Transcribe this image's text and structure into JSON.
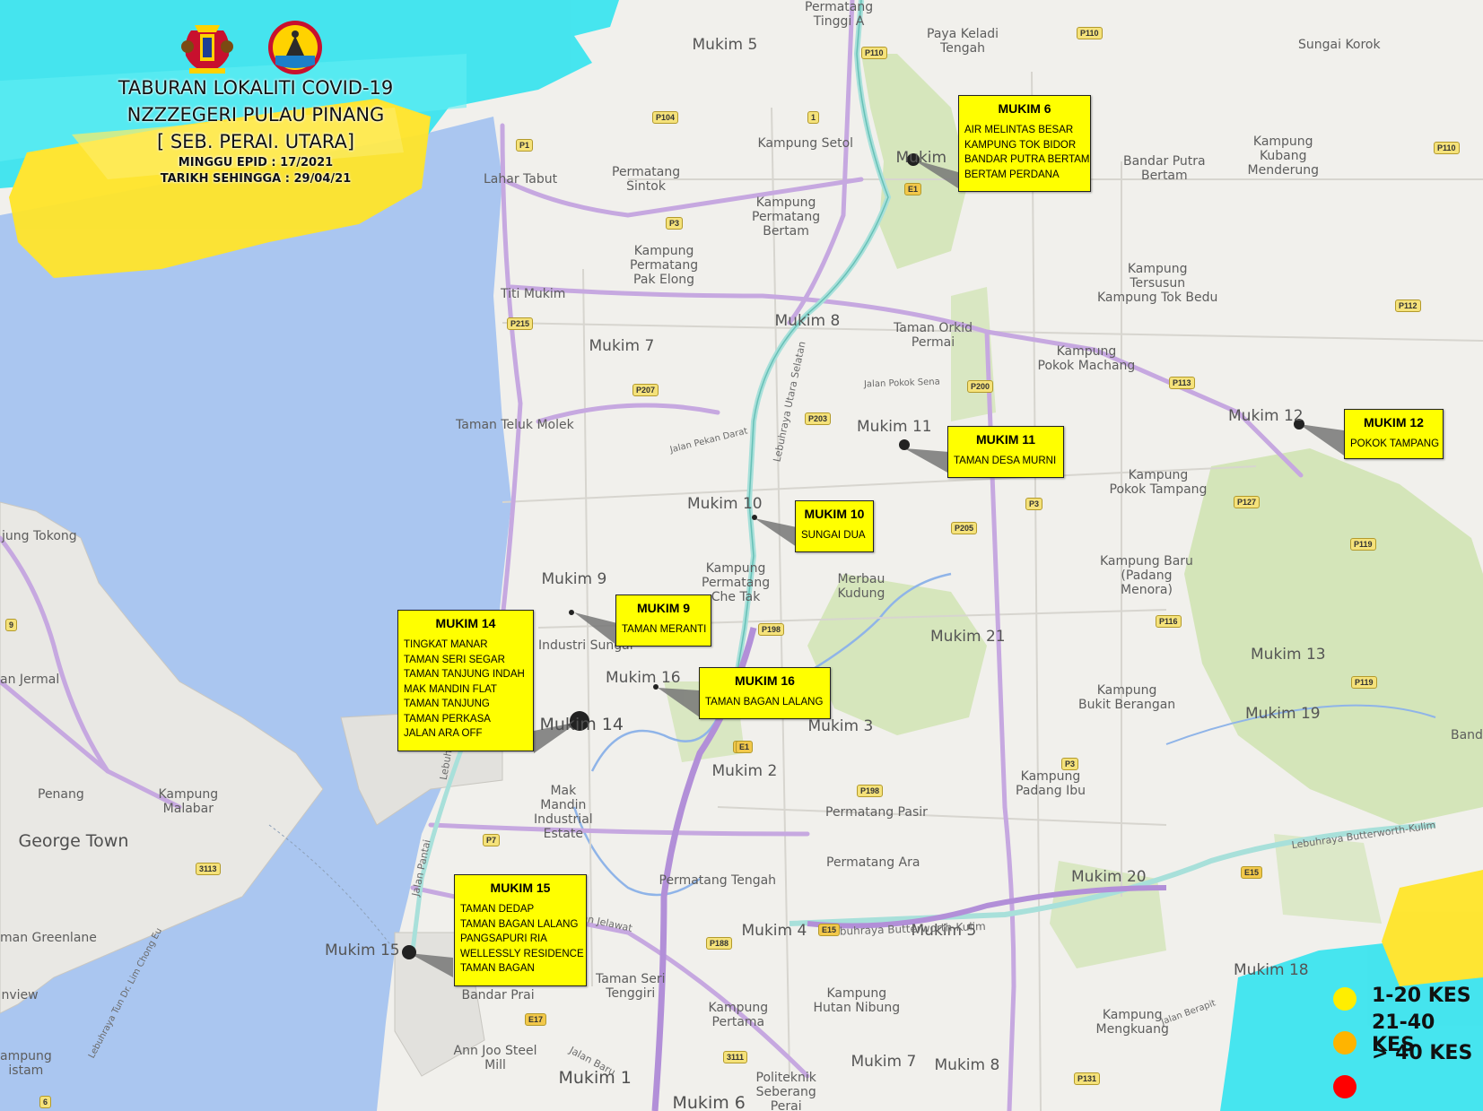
{
  "header": {
    "title_line1": "TABURAN LOKALITI COVID-19",
    "title_line2": "NZZZEGERI PULAU PINANG",
    "title_line3": "[ SEB. PERAI. UTARA]",
    "epid_week": "MINGGU EPID : 17/2021",
    "as_of_date": "TARIKH SEHINGGA : 29/04/21"
  },
  "callouts": {
    "mukim6": {
      "title": "MUKIM 6",
      "items": [
        "AIR MELINTAS BESAR",
        "KAMPUNG TOK BIDOR",
        "BANDAR PUTRA BERTAM",
        "BERTAM PERDANA"
      ]
    },
    "mukim12": {
      "title": "MUKIM 12",
      "items": [
        "POKOK TAMPANG"
      ]
    },
    "mukim11": {
      "title": "MUKIM 11",
      "items": [
        "TAMAN DESA MURNI"
      ]
    },
    "mukim10": {
      "title": "MUKIM 10",
      "items": [
        "SUNGAI DUA"
      ]
    },
    "mukim9": {
      "title": "MUKIM 9",
      "items": [
        "TAMAN MERANTI"
      ]
    },
    "mukim16": {
      "title": "MUKIM 16",
      "items": [
        "TAMAN BAGAN LALANG"
      ]
    },
    "mukim14": {
      "title": "MUKIM 14",
      "items": [
        "TINGKAT MANAR",
        "TAMAN SERI SEGAR",
        "TAMAN TANJUNG INDAH",
        "MAK MANDIN FLAT",
        "TAMAN TANJUNG",
        "TAMAN PERKASA",
        "JALAN ARA OFF"
      ]
    },
    "mukim15": {
      "title": "MUKIM 15",
      "items": [
        "TAMAN DEDAP",
        "TAMAN BAGAN LALANG",
        "PANGSAPURI RIA",
        "WELLESSLY RESIDENCE",
        "TAMAN BAGAN"
      ]
    }
  },
  "legend": {
    "low": {
      "label": "1-20 KES",
      "color": "#ffee00"
    },
    "mid": {
      "label": "21-40 KES",
      "color": "#ffb400"
    },
    "high": {
      "label": "> 40 KES",
      "color": "#ff0000"
    }
  },
  "place_labels": {
    "permatang_tinggi_a": "Permatang\nTinggi A",
    "mukim5_n": "Mukim 5",
    "paya_keladi": "Paya Keladi\nTengah",
    "sungai_korok": "Sungai Korok",
    "kampung_setol": "Kampung Setol",
    "mukim6": "Mukim",
    "bandar_putra": "Bandar Putra\nBertam",
    "kubang": "Kampung\nKubang\nMenderung",
    "lahar_tabut": "Lahar Tabut",
    "permatang_sintok": "Permatang\nSintok",
    "pp_bertam": "Kampung\nPermatang\nBertam",
    "pak_elong": "Kampung\nPermatang\nPak Elong",
    "tersusun": "Kampung\nTersusun\nKampung Tok Bedu",
    "titi_mukim": "Titi Mukim",
    "mukim8": "Mukim 8",
    "orkid": "Taman Orkid\nPermai",
    "mukim7": "Mukim 7",
    "pokok_machang": "Kampung\nPokok Machang",
    "teluk_molek": "Taman Teluk Molek",
    "mukim11": "Mukim 11",
    "mukim12": "Mukim 12",
    "pokok_tampang": "Kampung\nPokok Tampang",
    "mukim10": "Mukim 10",
    "tokong": "jung Tokong",
    "mukim9": "Mukim 9",
    "che_tak": "Kampung\nPermatang\nChe Tak",
    "merbau": "Merbau\nKudung",
    "kampung_baru": "Kampung Baru\n(Padang\nMenora)",
    "mukim21": "Mukim 21",
    "industri": "Industri Sungai",
    "mukim16": "Mukim 16",
    "mukim13": "Mukim 13",
    "jermal": "an Jermal",
    "berangan": "Kampung\nBukit Berangan",
    "mukim14": "Mukim 14",
    "mukim3": "Mukim 3",
    "mukim19": "Mukim 19",
    "band": "Band",
    "penang": "Penang",
    "malabar": "Kampung\nMalabar",
    "mukim2": "Mukim 2",
    "mak_mandin": "Mak\nMandin\nIndustrial\nEstate",
    "padang_ibu": "Kampung\nPadang Ibu",
    "george_town": "George Town",
    "permatang_pasir": "Permatang Pasir",
    "permatang_ara": "Permatang Ara",
    "permatang_tengah": "Permatang Tengah",
    "mukim20": "Mukim 20",
    "greenlane": "man Greenlane",
    "mukim4": "Mukim 4",
    "mukim5_s": "Mukim 5",
    "mukim15": "Mukim 15",
    "mukim18": "Mukim 18",
    "nview": "nview",
    "bandar_prai": "Bandar Prai",
    "seri_tenggiri": "Taman Seri\nTenggiri",
    "hutan_nibung": "Kampung\nHutan Nibung",
    "pertama": "Kampung\nPertama",
    "mengkuang": "Kampung\nMengkuang",
    "ampung": "ampung\nistam",
    "ann_joo": "Ann Joo Steel\nMill",
    "mukim1": "Mukim 1",
    "mukim7_s": "Mukim 7",
    "mukim8_s": "Mukim 8",
    "politeknik": "Politeknik\nSeberang\nPerai",
    "mukim6_s": "Mukim 6"
  },
  "road_labels": {
    "lebuhraya_utara": "Lebuhraya Utara Selatan",
    "bk_1": "Lebuhraya Butterworth-Kulim",
    "bk_2": "Lebuhraya Butterworth-Kulim",
    "jalan_pantai": "Jalan Pantai",
    "lebuh_raya": "Lebuh Raya",
    "lim_chong_eu": "Lebuhraya Tun Dr. Lim Chong Eu",
    "jalan_baru": "Jalan Baru",
    "jalan_pokok_sena": "Jalan Pokok Sena",
    "jalan_pekan_darat": "Jalan Pekan Darat",
    "jelawat": "an Jelawat",
    "jalan_berapit": "Jalan Berapit"
  },
  "route_shields": [
    "P110",
    "P110",
    "P110",
    "P104",
    "1",
    "P1",
    "E1",
    "P3",
    "P215",
    "P207",
    "P200",
    "P113",
    "P112",
    "P203",
    "P127",
    "P3",
    "P205",
    "P119",
    "P198",
    "E1",
    "P116",
    "P119",
    "E1",
    "P3",
    "P198",
    "P7",
    "3113",
    "E15",
    "E15",
    "P188",
    "E17",
    "3111",
    "P131",
    "6",
    "9"
  ]
}
